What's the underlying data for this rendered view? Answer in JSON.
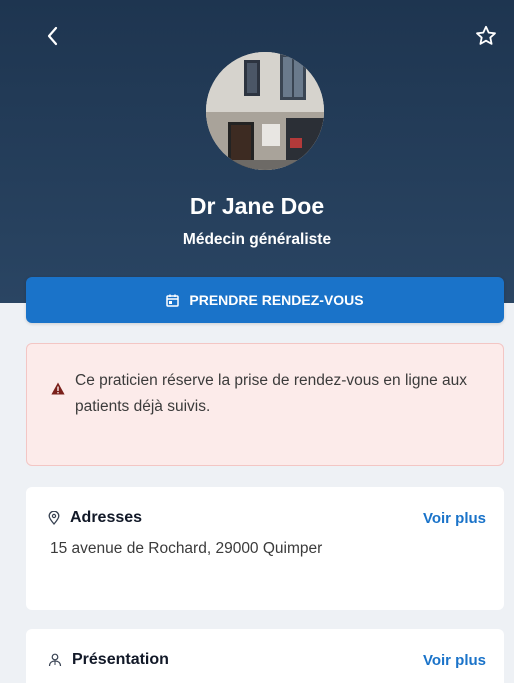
{
  "header": {
    "back_icon": "chevron-left-icon",
    "favorite_icon": "star-outline-icon"
  },
  "doctor": {
    "name": "Dr Jane Doe",
    "specialty": "Médecin généraliste"
  },
  "booking": {
    "button_label": "PRENDRE RENDEZ-VOUS",
    "icon": "calendar-icon"
  },
  "alert": {
    "icon": "warning-icon",
    "text": "Ce praticien réserve la prise de rendez-vous en ligne aux patients déjà suivis."
  },
  "addresses": {
    "icon": "location-pin-icon",
    "title": "Adresses",
    "link": "Voir plus",
    "value": "15 avenue de Rochard, 29000 Quimper"
  },
  "presentation": {
    "icon": "person-icon",
    "title": "Présentation",
    "link": "Voir plus"
  },
  "colors": {
    "header_bg": "#1e3550",
    "primary": "#1a73c9",
    "alert_bg": "#fcebea",
    "alert_icon": "#7a1f1a",
    "page_bg": "#eef1f5"
  }
}
